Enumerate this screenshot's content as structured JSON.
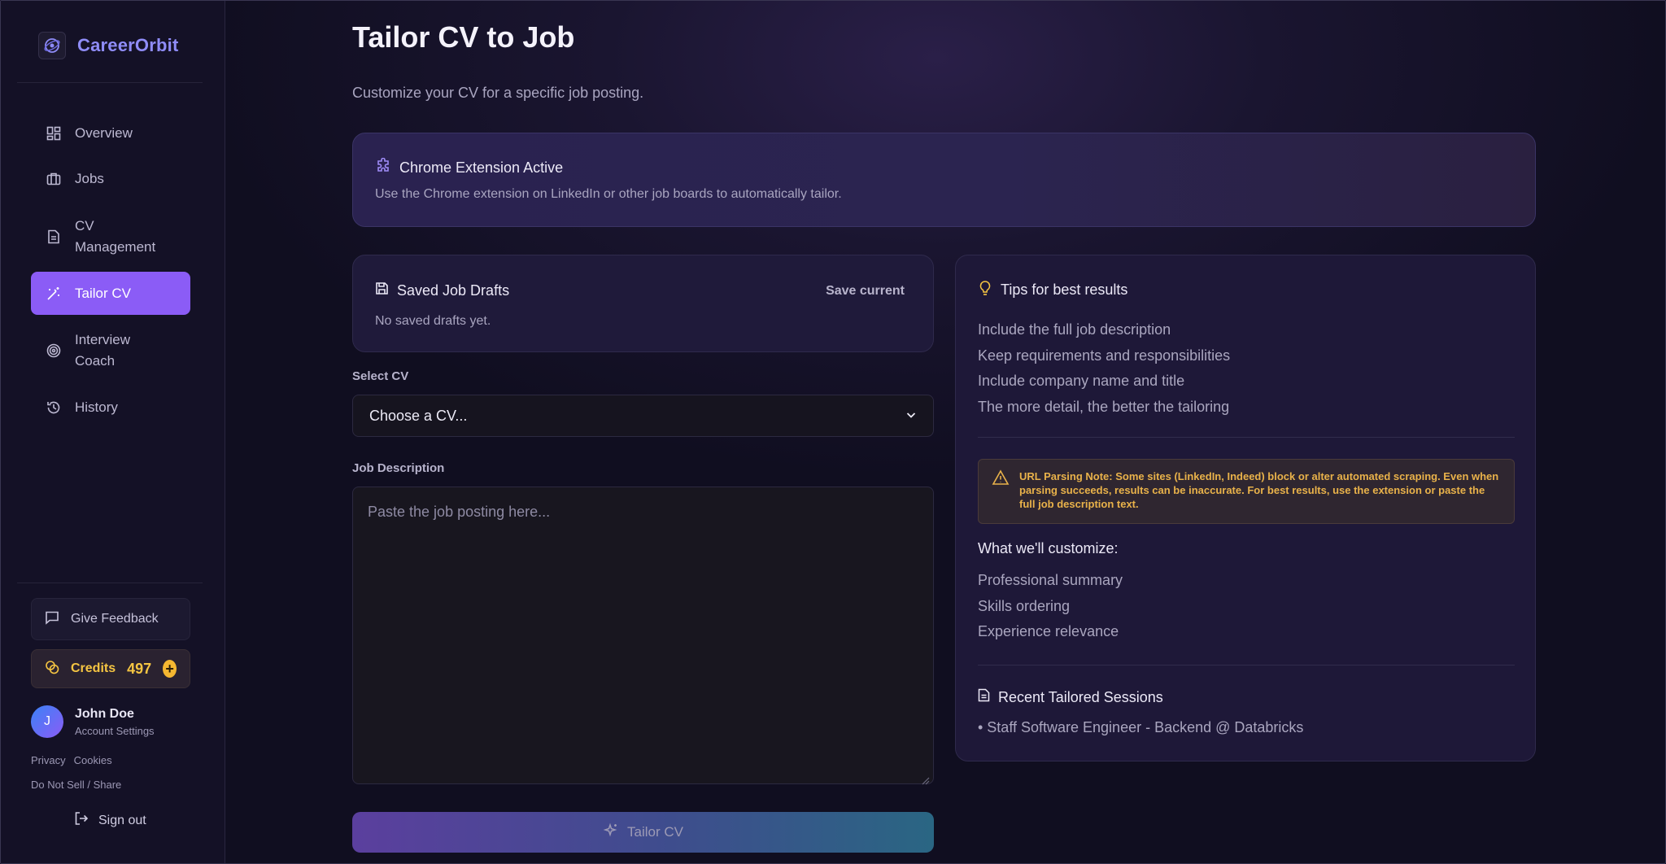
{
  "brand": {
    "name": "CareerOrbit",
    "logo_icon": "orbit-icon"
  },
  "sidebar": {
    "items": [
      {
        "label": "Overview",
        "icon": "dashboard-grid-icon"
      },
      {
        "label": "Jobs",
        "icon": "briefcase-icon"
      },
      {
        "label": "CV Management",
        "icon": "document-icon"
      },
      {
        "label": "Tailor CV",
        "icon": "magic-wand-icon",
        "active": true
      },
      {
        "label": "Interview Coach",
        "icon": "target-icon"
      },
      {
        "label": "History",
        "icon": "history-icon"
      }
    ],
    "feedback_label": "Give Feedback",
    "credits_label": "Credits",
    "credits_count": "497",
    "user_initial": "J",
    "user_name": "John Doe",
    "user_sub": "Account Settings",
    "privacy": "Privacy",
    "cookies": "Cookies",
    "do_not_sell": "Do Not Sell / Share",
    "sign_out": "Sign out"
  },
  "page": {
    "title": "Tailor CV to Job",
    "subtitle": "Customize your CV for a specific job posting."
  },
  "extension": {
    "title": "Chrome Extension Active",
    "description": "Use the Chrome extension on LinkedIn or other job boards to automatically tailor."
  },
  "drafts": {
    "title": "Saved Job Drafts",
    "save_current": "Save current",
    "empty": "No saved drafts yet."
  },
  "form": {
    "select_label": "Select CV",
    "select_value": "Choose a CV...",
    "description_label": "Job Description",
    "description_placeholder": "Paste the job posting here...",
    "submit_label": "Tailor CV"
  },
  "tips": {
    "title": "Tips for best results",
    "items": [
      "Include the full job description",
      "Keep requirements and responsibilities",
      "Include company name and title",
      "The more detail, the better the tailoring"
    ],
    "warning": "URL Parsing Note: Some sites (LinkedIn, Indeed) block or alter automated scraping. Even when parsing succeeds, results can be inaccurate. For best results, use the extension or paste the full job description text.",
    "customize_title": "What we'll customize:",
    "customize_items": [
      "Professional summary",
      "Skills ordering",
      "Experience relevance"
    ],
    "recent_title": "Recent Tailored Sessions",
    "recent_items": [
      "• Staff Software Engineer - Backend @ Databricks"
    ]
  },
  "colors": {
    "accent": "#8b5cf6",
    "brand_text": "#8f8cf7",
    "credits": "#f5c542",
    "warning": "#e9b24a"
  }
}
